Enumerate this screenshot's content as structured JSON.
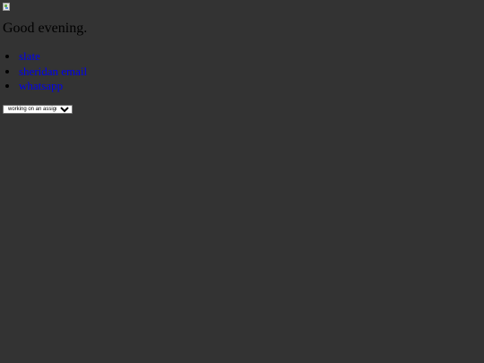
{
  "greeting": "Good evening.",
  "links": [
    {
      "label": "slate"
    },
    {
      "label": "sheridan email"
    },
    {
      "label": "whatsapp"
    }
  ],
  "assignment_select": {
    "selected": "working on an assignment?"
  },
  "colors": {
    "background": "#333333",
    "link": "#0000ee",
    "text": "#000000"
  }
}
